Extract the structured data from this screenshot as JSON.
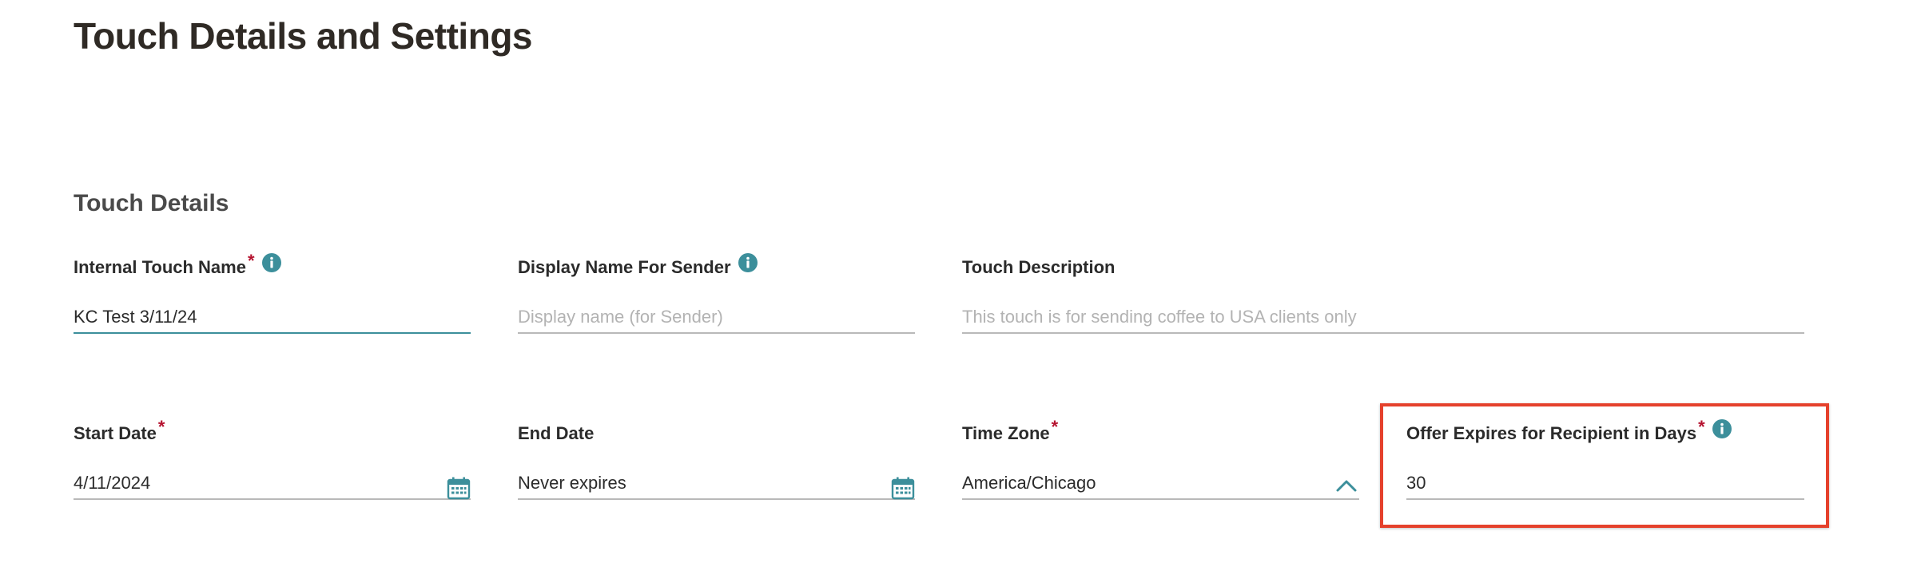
{
  "page": {
    "title": "Touch Details and Settings"
  },
  "section": {
    "title": "Touch Details"
  },
  "fields": {
    "internal_touch_name": {
      "label": "Internal Touch Name",
      "required_mark": "*",
      "value": "KC Test 3/11/24",
      "placeholder": ""
    },
    "display_name_for_sender": {
      "label": "Display Name For Sender",
      "value": "",
      "placeholder": "Display name (for Sender)"
    },
    "touch_description": {
      "label": "Touch Description",
      "value": "",
      "placeholder": "This touch is for sending coffee to USA clients only"
    },
    "start_date": {
      "label": "Start Date",
      "required_mark": "*",
      "value": "4/11/2024"
    },
    "end_date": {
      "label": "End Date",
      "value": "Never expires"
    },
    "time_zone": {
      "label": "Time Zone",
      "required_mark": "*",
      "value": "America/Chicago"
    },
    "offer_expires_days": {
      "label": "Offer Expires for Recipient in Days",
      "required_mark": "*",
      "value": "30"
    }
  },
  "icons": {
    "info": "info-icon",
    "calendar": "calendar-icon",
    "chevron": "chevron-up-icon"
  },
  "colors": {
    "accent": "#3c8f9b",
    "required": "#b5122f",
    "highlight": "#e5412c"
  }
}
